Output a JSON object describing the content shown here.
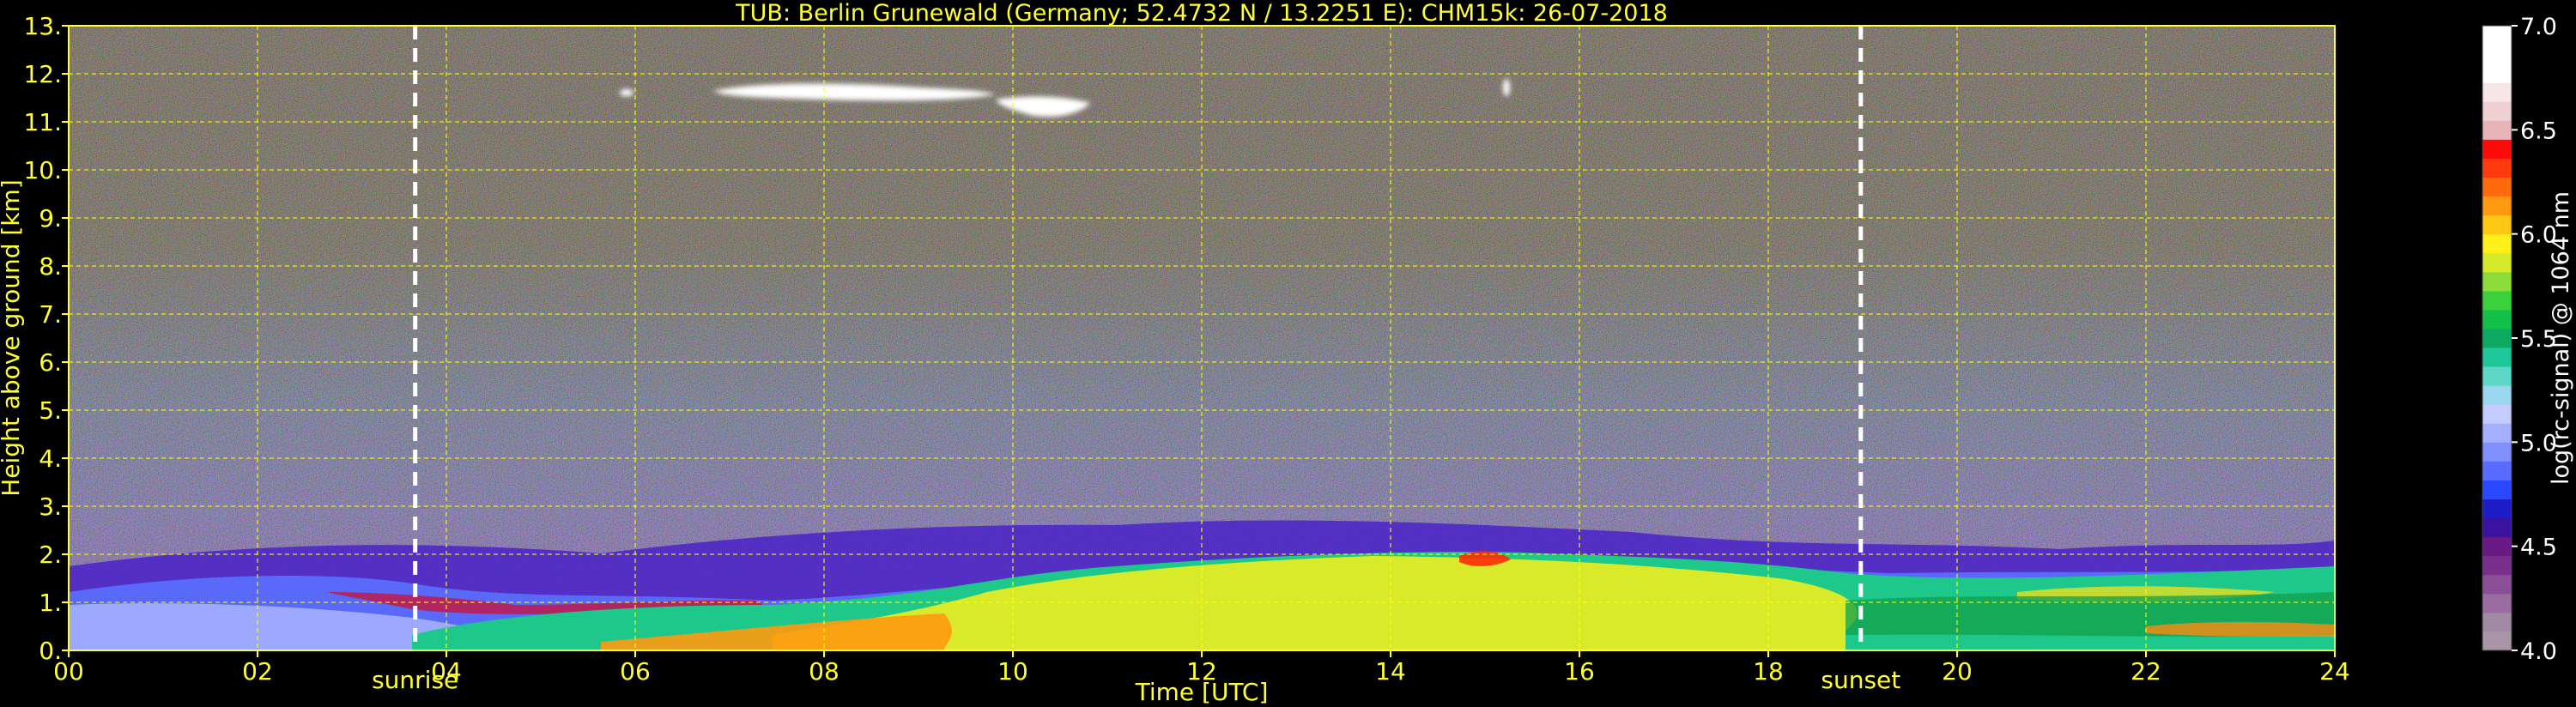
{
  "chart_data": {
    "type": "heatmap",
    "title": "TUB: Berlin Grunewald (Germany; 52.4732 N / 13.2251 E):    CHM15k: 26-07-2018",
    "xlabel": "Time [UTC]",
    "ylabel": "Height above ground [km]",
    "xlim": [
      0,
      24
    ],
    "ylim": [
      0,
      13
    ],
    "x_ticks": [
      0,
      2,
      4,
      6,
      8,
      10,
      12,
      14,
      16,
      18,
      20,
      22,
      24
    ],
    "x_tick_labels": [
      "00",
      "02",
      "04",
      "06",
      "08",
      "10",
      "12",
      "14",
      "16",
      "18",
      "20",
      "22",
      "24"
    ],
    "y_ticks": [
      0,
      1,
      2,
      3,
      4,
      5,
      6,
      7,
      8,
      9,
      10,
      11,
      12,
      13
    ],
    "y_tick_labels": [
      "0.",
      "1.",
      "2.",
      "3.",
      "4.",
      "5.",
      "6.",
      "7.",
      "8.",
      "9.",
      "10.",
      "11.",
      "12.",
      "13."
    ],
    "grid": true,
    "markers": [
      {
        "label": "sunrise",
        "x": 3.67
      },
      {
        "label": "sunset",
        "x": 18.98
      }
    ],
    "colorbar": {
      "label": "log(rc-signal) @ 1064 nm",
      "range": [
        4.0,
        7.0
      ],
      "ticks": [
        4.0,
        4.5,
        5.0,
        5.5,
        6.0,
        6.5,
        7.0
      ],
      "tick_labels": [
        "4.0",
        "4.5",
        "5.0",
        "5.5",
        "6.0",
        "6.5",
        "7.0"
      ],
      "colors": [
        "#a895a8",
        "#a18aa4",
        "#9a6da0",
        "#8a4f96",
        "#7a2f8c",
        "#6a1a85",
        "#3a12a0",
        "#1e1ec8",
        "#2a48ff",
        "#5a6cff",
        "#8090ff",
        "#a4b0ff",
        "#c4ccff",
        "#9ad6ee",
        "#5ed6c8",
        "#1ec89a",
        "#0eaa64",
        "#12c04a",
        "#3ad23a",
        "#8cdc3a",
        "#d4ea2a",
        "#fff01a",
        "#ffc814",
        "#ff9a10",
        "#ff6a0e",
        "#ff3a0c",
        "#ff0a0a",
        "#e8b4b8",
        "#efd0d3",
        "#f7e6e8",
        "#ffffff",
        "#ffffff",
        "#ffffff"
      ]
    },
    "colors": {
      "text": "#ffff33",
      "grid": "#ffff00",
      "axis_frame": "#ffff33",
      "background": "#000000",
      "colorbar_text": "#ffffff"
    }
  }
}
